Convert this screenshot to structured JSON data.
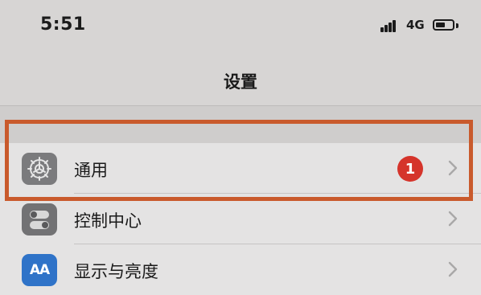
{
  "status_bar": {
    "time": "5:51",
    "network": "4G",
    "icons": [
      "signal-icon",
      "battery-icon"
    ],
    "battery_level": 0.6
  },
  "header": {
    "title": "设置"
  },
  "settings": {
    "items": [
      {
        "label": "通用",
        "icon": "gear-icon",
        "badge": "1",
        "chevron": "chevron-right-icon"
      },
      {
        "label": "控制中心",
        "icon": "control-center-icon",
        "chevron": "chevron-right-icon"
      },
      {
        "label": "显示与亮度",
        "icon": "display-brightness-icon",
        "icon_text": "AA",
        "chevron": "chevron-right-icon"
      }
    ]
  },
  "annotation": {
    "highlight_color": "#c95a2c"
  },
  "colors": {
    "background": "#d7d5d4",
    "badge": "#d5342b",
    "display_icon": "#2f73c8"
  }
}
